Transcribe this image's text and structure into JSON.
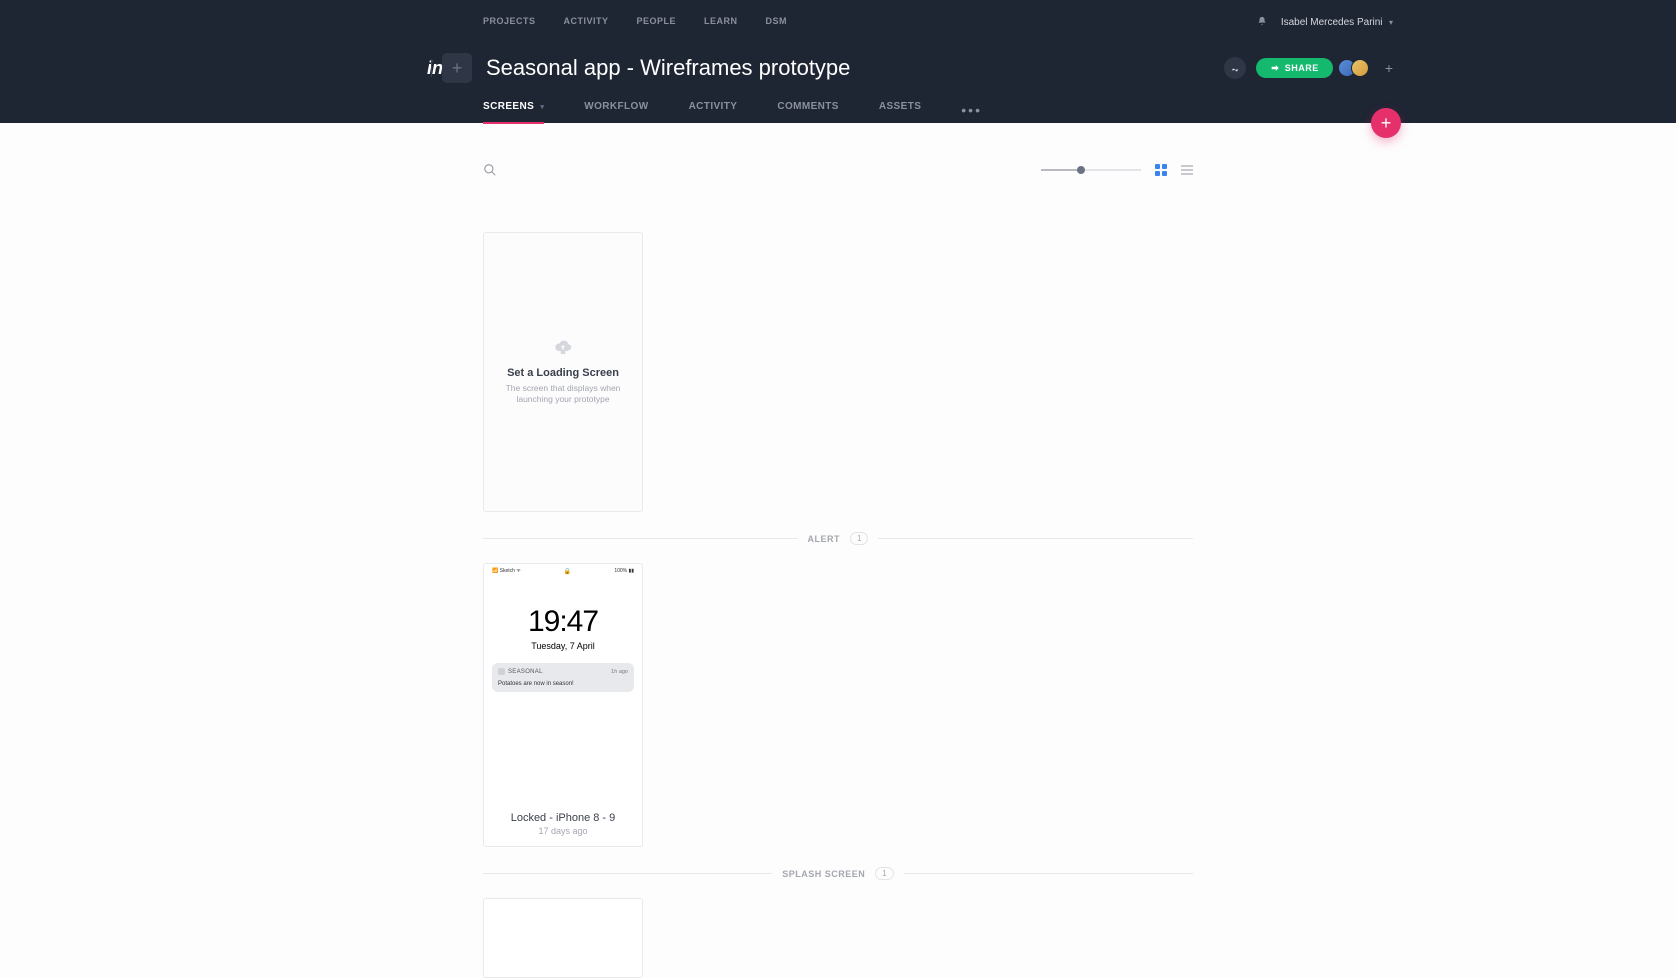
{
  "topNav": {
    "projects": "PROJECTS",
    "activity": "ACTIVITY",
    "people": "PEOPLE",
    "learn": "LEARN",
    "dsm": "DSM"
  },
  "user": {
    "name": "Isabel Mercedes Parini"
  },
  "project": {
    "title": "Seasonal app - Wireframes prototype"
  },
  "share": {
    "label": "SHARE"
  },
  "tabs": {
    "screens": "SCREENS",
    "workflow": "WORKFLOW",
    "activity": "ACTIVITY",
    "comments": "COMMENTS",
    "assets": "ASSETS"
  },
  "loadingCard": {
    "title": "Set a Loading Screen",
    "subtitle": "The screen that displays when launching your prototype"
  },
  "sections": {
    "alert": {
      "label": "ALERT",
      "count": "1"
    },
    "splash": {
      "label": "SPLASH SCREEN",
      "count": "1"
    }
  },
  "alertScreen": {
    "thumb": {
      "statusLeft": "📶 Sketch ᯤ",
      "statusRight": "100% ▮▮",
      "time": "19:47",
      "date": "Tuesday, 7 April",
      "notifApp": "SEASONAL",
      "notifWhen": "1h ago",
      "notifBody": "Potatoes are now in season!"
    },
    "name": "Locked - iPhone 8 - 9",
    "timeAgo": "17 days ago"
  }
}
